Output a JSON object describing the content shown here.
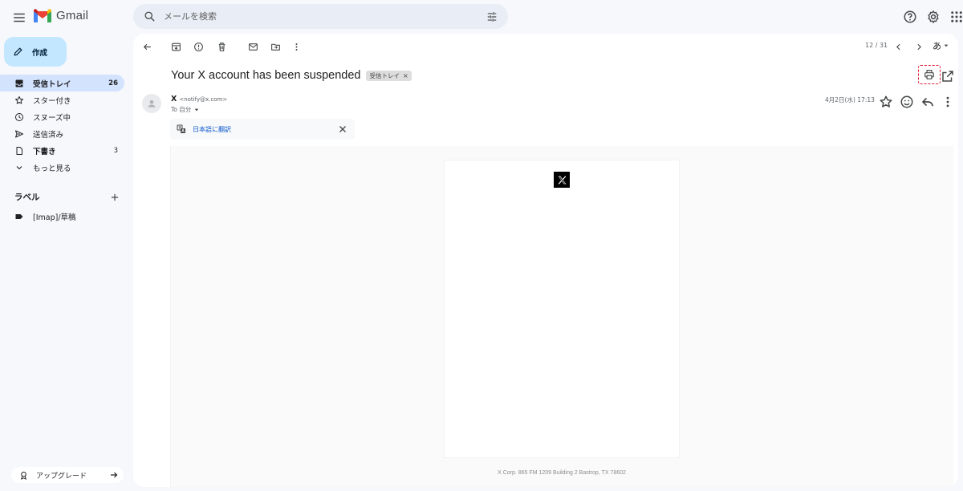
{
  "app": {
    "name": "Gmail"
  },
  "search": {
    "placeholder": "メールを検索"
  },
  "sidebar": {
    "compose_label": "作成",
    "items": [
      {
        "label": "受信トレイ",
        "count": "26",
        "icon": "inbox-icon"
      },
      {
        "label": "スター付き",
        "count": "",
        "icon": "star-icon"
      },
      {
        "label": "スヌーズ中",
        "count": "",
        "icon": "clock-icon"
      },
      {
        "label": "送信済み",
        "count": "",
        "icon": "send-icon"
      },
      {
        "label": "下書き",
        "count": "3",
        "icon": "draft-icon"
      },
      {
        "label": "もっと見る",
        "count": "",
        "icon": "chevron-down-icon"
      }
    ],
    "labels_heading": "ラベル",
    "labels": [
      {
        "label": "[Imap]/草稿"
      }
    ],
    "upgrade_label": "アップグレード"
  },
  "toolbar": {
    "pager": "12 / 31",
    "lang": "あ"
  },
  "message": {
    "subject": "Your X account has been suspended",
    "chip": "受信トレイ",
    "chip_close": "×",
    "sender_name": "X",
    "sender_email": "<notify@x.com>",
    "to": "To 自分",
    "date": "4月2日(水) 17:13",
    "translate_label": "日本語に翻訳",
    "footer": "X Corp. 865 FM 1209 Building 2 Bastrop, TX 78602"
  },
  "colors": {
    "background": "#f6f8fc",
    "compose": "#c2e7ff",
    "active_nav": "#d3e3fd",
    "link": "#0b57d0",
    "highlight": "#e0162b"
  }
}
